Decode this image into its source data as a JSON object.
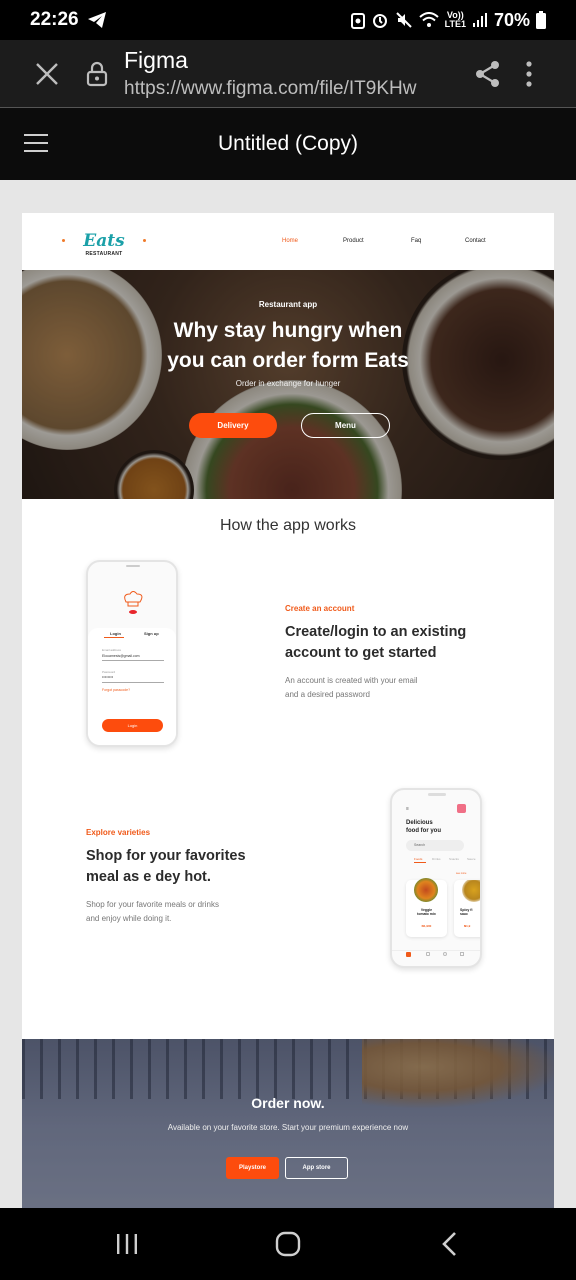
{
  "status": {
    "time": "22:26",
    "volte_top": "Vo))",
    "volte_bottom": "LTE1",
    "battery": "70%"
  },
  "browser": {
    "title": "Figma",
    "url": "https://www.figma.com/file/IT9KHw"
  },
  "figma": {
    "file_title": "Untitled (Copy)"
  },
  "design": {
    "logo": {
      "name": "Eats",
      "tag": "RESTAURANT"
    },
    "nav": [
      "Home",
      "Product",
      "Faq",
      "Contact"
    ],
    "hero": {
      "eyebrow": "Restaurant app",
      "title_line1": "Why stay hungry when",
      "title_line2": "you can order form Eats",
      "subtitle": "Order in exchange for hunger",
      "btn_primary": "Delivery",
      "btn_secondary": "Menu"
    },
    "how_title": "How the app works",
    "step1": {
      "eyebrow": "Create an account",
      "title_line1": "Create/login to an existing",
      "title_line2": "account to get started",
      "desc_line1": "An account is created with your email",
      "desc_line2": "and a desired password",
      "phone": {
        "tab_login": "Login",
        "tab_signup": "Sign up",
        "email_label": "Email address",
        "email_value": "Elouamesis@gmail.com",
        "password_label": "Password",
        "password_value": "••••••••",
        "forgot": "Forgot passcode?",
        "button": "Login"
      }
    },
    "step2": {
      "eyebrow": "Explore varieties",
      "title_line1": "Shop for your favorites",
      "title_line2": "meal as e dey hot.",
      "desc_line1": "Shop for your favorite meals or drinks",
      "desc_line2": "and enjoy while doing it.",
      "phone": {
        "heading_line1": "Delicious",
        "heading_line2": "food for you",
        "search": "Search",
        "cats": [
          "Foods",
          "Drinks",
          "Snacks",
          "Sauce"
        ],
        "see_more": "see more",
        "item1_line1": "Veggie",
        "item1_line2": "tomato mix",
        "item1_price": "₦1,900",
        "item2_line1": "Spicy fi",
        "item2_line2": "sauc",
        "item2_price": "₦1,9"
      }
    },
    "cta": {
      "title": "Order now.",
      "subtitle": "Available on your favorite store. Start your premium experience now",
      "btn_playstore": "Playstore",
      "btn_appstore": "App store"
    }
  },
  "colors": {
    "accent": "#fd4c0d",
    "logo": "#1aa0a8"
  }
}
